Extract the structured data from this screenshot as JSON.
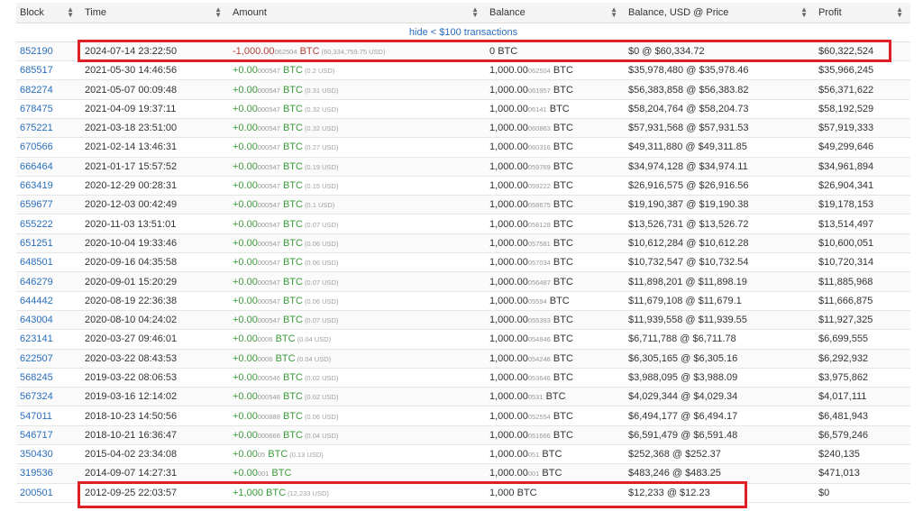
{
  "headers": [
    "Block",
    "Time",
    "Amount",
    "Balance",
    "Balance, USD @ Price",
    "Profit"
  ],
  "filter_label": "hide < $100 transactions",
  "colors": {
    "link": "#2a6ebb",
    "positive": "#3a9a3a",
    "negative": "#b3403a",
    "highlight": "#e01e25"
  },
  "rows": [
    {
      "block": "852190",
      "time": "2024-07-14 23:22:50",
      "amount_main": "-1,000.00",
      "amount_dust": "062504",
      "amount_unit": "BTC",
      "amount_usd": "(60,334,759.75 USD)",
      "sign": "neg",
      "bal_main": "0",
      "bal_dust": "",
      "bal_unit": "BTC",
      "usd": "$0 @ $60,334.72",
      "profit": "$60,322,524"
    },
    {
      "block": "685517",
      "time": "2021-05-30 14:46:56",
      "amount_main": "+0.00",
      "amount_dust": "000547",
      "amount_unit": "BTC",
      "amount_usd": "(0.2 USD)",
      "sign": "pos",
      "bal_main": "1,000.00",
      "bal_dust": "062504",
      "bal_unit": "BTC",
      "usd": "$35,978,480 @ $35,978.46",
      "profit": "$35,966,245"
    },
    {
      "block": "682274",
      "time": "2021-05-07 00:09:48",
      "amount_main": "+0.00",
      "amount_dust": "000547",
      "amount_unit": "BTC",
      "amount_usd": "(0.31 USD)",
      "sign": "pos",
      "bal_main": "1,000.00",
      "bal_dust": "061957",
      "bal_unit": "BTC",
      "usd": "$56,383,858 @ $56,383.82",
      "profit": "$56,371,622"
    },
    {
      "block": "678475",
      "time": "2021-04-09 19:37:11",
      "amount_main": "+0.00",
      "amount_dust": "000547",
      "amount_unit": "BTC",
      "amount_usd": "(0.32 USD)",
      "sign": "pos",
      "bal_main": "1,000.00",
      "bal_dust": "06141",
      "bal_unit": "BTC",
      "usd": "$58,204,764 @ $58,204.73",
      "profit": "$58,192,529"
    },
    {
      "block": "675221",
      "time": "2021-03-18 23:51:00",
      "amount_main": "+0.00",
      "amount_dust": "000547",
      "amount_unit": "BTC",
      "amount_usd": "(0.32 USD)",
      "sign": "pos",
      "bal_main": "1,000.00",
      "bal_dust": "060863",
      "bal_unit": "BTC",
      "usd": "$57,931,568 @ $57,931.53",
      "profit": "$57,919,333"
    },
    {
      "block": "670566",
      "time": "2021-02-14 13:46:31",
      "amount_main": "+0.00",
      "amount_dust": "000547",
      "amount_unit": "BTC",
      "amount_usd": "(0.27 USD)",
      "sign": "pos",
      "bal_main": "1,000.00",
      "bal_dust": "060316",
      "bal_unit": "BTC",
      "usd": "$49,311,880 @ $49,311.85",
      "profit": "$49,299,646"
    },
    {
      "block": "666464",
      "time": "2021-01-17 15:57:52",
      "amount_main": "+0.00",
      "amount_dust": "000547",
      "amount_unit": "BTC",
      "amount_usd": "(0.19 USD)",
      "sign": "pos",
      "bal_main": "1,000.00",
      "bal_dust": "059769",
      "bal_unit": "BTC",
      "usd": "$34,974,128 @ $34,974.11",
      "profit": "$34,961,894"
    },
    {
      "block": "663419",
      "time": "2020-12-29 00:28:31",
      "amount_main": "+0.00",
      "amount_dust": "000547",
      "amount_unit": "BTC",
      "amount_usd": "(0.15 USD)",
      "sign": "pos",
      "bal_main": "1,000.00",
      "bal_dust": "059222",
      "bal_unit": "BTC",
      "usd": "$26,916,575 @ $26,916.56",
      "profit": "$26,904,341"
    },
    {
      "block": "659677",
      "time": "2020-12-03 00:42:49",
      "amount_main": "+0.00",
      "amount_dust": "000547",
      "amount_unit": "BTC",
      "amount_usd": "(0.1 USD)",
      "sign": "pos",
      "bal_main": "1,000.00",
      "bal_dust": "058675",
      "bal_unit": "BTC",
      "usd": "$19,190,387 @ $19,190.38",
      "profit": "$19,178,153"
    },
    {
      "block": "655222",
      "time": "2020-11-03 13:51:01",
      "amount_main": "+0.00",
      "amount_dust": "000547",
      "amount_unit": "BTC",
      "amount_usd": "(0.07 USD)",
      "sign": "pos",
      "bal_main": "1,000.00",
      "bal_dust": "058128",
      "bal_unit": "BTC",
      "usd": "$13,526,731 @ $13,526.72",
      "profit": "$13,514,497"
    },
    {
      "block": "651251",
      "time": "2020-10-04 19:33:46",
      "amount_main": "+0.00",
      "amount_dust": "000547",
      "amount_unit": "BTC",
      "amount_usd": "(0.06 USD)",
      "sign": "pos",
      "bal_main": "1,000.00",
      "bal_dust": "057581",
      "bal_unit": "BTC",
      "usd": "$10,612,284 @ $10,612.28",
      "profit": "$10,600,051"
    },
    {
      "block": "648501",
      "time": "2020-09-16 04:35:58",
      "amount_main": "+0.00",
      "amount_dust": "000547",
      "amount_unit": "BTC",
      "amount_usd": "(0.06 USD)",
      "sign": "pos",
      "bal_main": "1,000.00",
      "bal_dust": "057034",
      "bal_unit": "BTC",
      "usd": "$10,732,547 @ $10,732.54",
      "profit": "$10,720,314"
    },
    {
      "block": "646279",
      "time": "2020-09-01 15:20:29",
      "amount_main": "+0.00",
      "amount_dust": "000547",
      "amount_unit": "BTC",
      "amount_usd": "(0.07 USD)",
      "sign": "pos",
      "bal_main": "1,000.00",
      "bal_dust": "056487",
      "bal_unit": "BTC",
      "usd": "$11,898,201 @ $11,898.19",
      "profit": "$11,885,968"
    },
    {
      "block": "644442",
      "time": "2020-08-19 22:36:38",
      "amount_main": "+0.00",
      "amount_dust": "000547",
      "amount_unit": "BTC",
      "amount_usd": "(0.06 USD)",
      "sign": "pos",
      "bal_main": "1,000.00",
      "bal_dust": "05594",
      "bal_unit": "BTC",
      "usd": "$11,679,108 @ $11,679.1",
      "profit": "$11,666,875"
    },
    {
      "block": "643004",
      "time": "2020-08-10 04:24:02",
      "amount_main": "+0.00",
      "amount_dust": "000547",
      "amount_unit": "BTC",
      "amount_usd": "(0.07 USD)",
      "sign": "pos",
      "bal_main": "1,000.00",
      "bal_dust": "055393",
      "bal_unit": "BTC",
      "usd": "$11,939,558 @ $11,939.55",
      "profit": "$11,927,325"
    },
    {
      "block": "623141",
      "time": "2020-03-27 09:46:01",
      "amount_main": "+0.00",
      "amount_dust": "0006",
      "amount_unit": "BTC",
      "amount_usd": "(0.04 USD)",
      "sign": "pos",
      "bal_main": "1,000.00",
      "bal_dust": "054846",
      "bal_unit": "BTC",
      "usd": "$6,711,788 @ $6,711.78",
      "profit": "$6,699,555"
    },
    {
      "block": "622507",
      "time": "2020-03-22 08:43:53",
      "amount_main": "+0.00",
      "amount_dust": "0006",
      "amount_unit": "BTC",
      "amount_usd": "(0.04 USD)",
      "sign": "pos",
      "bal_main": "1,000.00",
      "bal_dust": "054246",
      "bal_unit": "BTC",
      "usd": "$6,305,165 @ $6,305.16",
      "profit": "$6,292,932"
    },
    {
      "block": "568245",
      "time": "2019-03-22 08:06:53",
      "amount_main": "+0.00",
      "amount_dust": "000546",
      "amount_unit": "BTC",
      "amount_usd": "(0.02 USD)",
      "sign": "pos",
      "bal_main": "1,000.00",
      "bal_dust": "053646",
      "bal_unit": "BTC",
      "usd": "$3,988,095 @ $3,988.09",
      "profit": "$3,975,862"
    },
    {
      "block": "567324",
      "time": "2019-03-16 12:14:02",
      "amount_main": "+0.00",
      "amount_dust": "000546",
      "amount_unit": "BTC",
      "amount_usd": "(0.02 USD)",
      "sign": "pos",
      "bal_main": "1,000.00",
      "bal_dust": "0531",
      "bal_unit": "BTC",
      "usd": "$4,029,344 @ $4,029.34",
      "profit": "$4,017,111"
    },
    {
      "block": "547011",
      "time": "2018-10-23 14:50:56",
      "amount_main": "+0.00",
      "amount_dust": "000888",
      "amount_unit": "BTC",
      "amount_usd": "(0.06 USD)",
      "sign": "pos",
      "bal_main": "1,000.00",
      "bal_dust": "052554",
      "bal_unit": "BTC",
      "usd": "$6,494,177 @ $6,494.17",
      "profit": "$6,481,943"
    },
    {
      "block": "546717",
      "time": "2018-10-21 16:36:47",
      "amount_main": "+0.00",
      "amount_dust": "000666",
      "amount_unit": "BTC",
      "amount_usd": "(0.04 USD)",
      "sign": "pos",
      "bal_main": "1,000.00",
      "bal_dust": "051666",
      "bal_unit": "BTC",
      "usd": "$6,591,479 @ $6,591.48",
      "profit": "$6,579,246"
    },
    {
      "block": "350430",
      "time": "2015-04-02 23:34:08",
      "amount_main": "+0.00",
      "amount_dust": "05",
      "amount_unit": "BTC",
      "amount_usd": "(0.13 USD)",
      "sign": "pos",
      "bal_main": "1,000.00",
      "bal_dust": "051",
      "bal_unit": "BTC",
      "usd": "$252,368 @ $252.37",
      "profit": "$240,135"
    },
    {
      "block": "319536",
      "time": "2014-09-07 14:27:31",
      "amount_main": "+0.00",
      "amount_dust": "001",
      "amount_unit": "BTC",
      "amount_usd": "",
      "sign": "pos",
      "bal_main": "1,000.00",
      "bal_dust": "001",
      "bal_unit": "BTC",
      "usd": "$483,246 @ $483.25",
      "profit": "$471,013"
    },
    {
      "block": "200501",
      "time": "2012-09-25 22:03:57",
      "amount_main": "+1,000",
      "amount_dust": "",
      "amount_unit": "BTC",
      "amount_usd": "(12,233 USD)",
      "sign": "pos",
      "bal_main": "1,000",
      "bal_dust": "",
      "bal_unit": "BTC",
      "usd": "$12,233 @ $12.23",
      "profit": "$0"
    }
  ]
}
